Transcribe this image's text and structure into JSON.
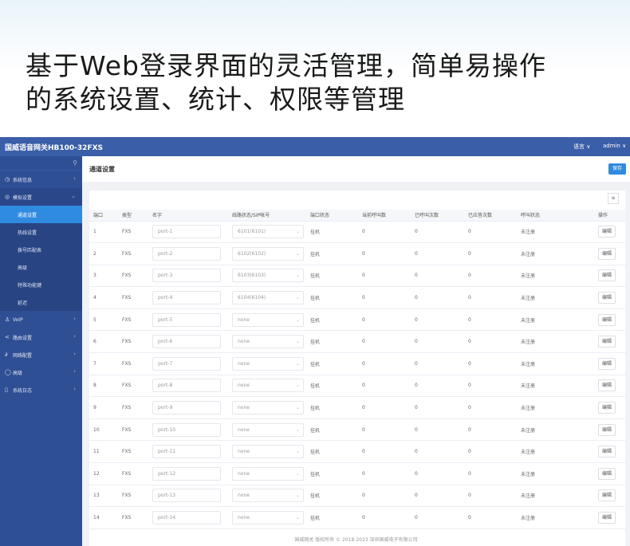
{
  "banner": {
    "line1": "基于Web登录界面的灵活管理，简单易操作",
    "line2": "的系统设置、统计、权限等管理"
  },
  "topbar": {
    "brand": "国威语音网关HB100-32FXS",
    "language": "语言 ∨",
    "user": "admin ∨"
  },
  "sidebar": {
    "items": [
      {
        "label": "系统信息",
        "icon": "gauge-icon"
      },
      {
        "label": "模拟设置",
        "icon": "phone-icon"
      },
      {
        "label": "VoIP",
        "icon": "user-icon"
      },
      {
        "label": "路由设置",
        "icon": "share-icon"
      },
      {
        "label": "网络配置",
        "icon": "link-icon"
      },
      {
        "label": "高级",
        "icon": "circle-icon"
      },
      {
        "label": "系统日志",
        "icon": "doc-icon"
      }
    ],
    "sub_items": [
      "通道设置",
      "热线设置",
      "拨号匹配表",
      "高级",
      "特殊功能键",
      "延迟"
    ]
  },
  "page": {
    "title": "通道设置",
    "save_label": "保存"
  },
  "table": {
    "headers": [
      "端口",
      "类型",
      "名字",
      "线路状态/SIP帐号",
      "端口状态",
      "当前呼叫数",
      "已呼叫次数",
      "已应答次数",
      "呼叫状态",
      "操作"
    ],
    "rows": [
      {
        "port": "1",
        "type": "FXS",
        "name": "port-1",
        "account": "6101(6101)",
        "status": "挂机",
        "current": "0",
        "called": "0",
        "answered": "0",
        "call_status": "未注册",
        "action": "编辑"
      },
      {
        "port": "2",
        "type": "FXS",
        "name": "port-2",
        "account": "6102(6102)",
        "status": "挂机",
        "current": "0",
        "called": "0",
        "answered": "0",
        "call_status": "未注册",
        "action": "编辑"
      },
      {
        "port": "3",
        "type": "FXS",
        "name": "port-3",
        "account": "6103(6103)",
        "status": "挂机",
        "current": "0",
        "called": "0",
        "answered": "0",
        "call_status": "未注册",
        "action": "编辑"
      },
      {
        "port": "4",
        "type": "FXS",
        "name": "port-4",
        "account": "6104(6104)",
        "status": "挂机",
        "current": "0",
        "called": "0",
        "answered": "0",
        "call_status": "未注册",
        "action": "编辑"
      },
      {
        "port": "5",
        "type": "FXS",
        "name": "port-5",
        "account": "none",
        "status": "挂机",
        "current": "0",
        "called": "0",
        "answered": "0",
        "call_status": "未注册",
        "action": "编辑"
      },
      {
        "port": "6",
        "type": "FXS",
        "name": "port-6",
        "account": "none",
        "status": "挂机",
        "current": "0",
        "called": "0",
        "answered": "0",
        "call_status": "未注册",
        "action": "编辑"
      },
      {
        "port": "7",
        "type": "FXS",
        "name": "port-7",
        "account": "none",
        "status": "挂机",
        "current": "0",
        "called": "0",
        "answered": "0",
        "call_status": "未注册",
        "action": "编辑"
      },
      {
        "port": "8",
        "type": "FXS",
        "name": "port-8",
        "account": "none",
        "status": "挂机",
        "current": "0",
        "called": "0",
        "answered": "0",
        "call_status": "未注册",
        "action": "编辑"
      },
      {
        "port": "9",
        "type": "FXS",
        "name": "port-9",
        "account": "none",
        "status": "挂机",
        "current": "0",
        "called": "0",
        "answered": "0",
        "call_status": "未注册",
        "action": "编辑"
      },
      {
        "port": "10",
        "type": "FXS",
        "name": "port-10",
        "account": "none",
        "status": "挂机",
        "current": "0",
        "called": "0",
        "answered": "0",
        "call_status": "未注册",
        "action": "编辑"
      },
      {
        "port": "11",
        "type": "FXS",
        "name": "port-11",
        "account": "none",
        "status": "挂机",
        "current": "0",
        "called": "0",
        "answered": "0",
        "call_status": "未注册",
        "action": "编辑"
      },
      {
        "port": "12",
        "type": "FXS",
        "name": "port-12",
        "account": "none",
        "status": "挂机",
        "current": "0",
        "called": "0",
        "answered": "0",
        "call_status": "未注册",
        "action": "编辑"
      },
      {
        "port": "13",
        "type": "FXS",
        "name": "port-13",
        "account": "none",
        "status": "挂机",
        "current": "0",
        "called": "0",
        "answered": "0",
        "call_status": "未注册",
        "action": "编辑"
      },
      {
        "port": "14",
        "type": "FXS",
        "name": "port-14",
        "account": "none",
        "status": "挂机",
        "current": "0",
        "called": "0",
        "answered": "0",
        "call_status": "未注册",
        "action": "编辑"
      }
    ]
  },
  "footer": "国威网关 版权所有 © 2018-2023 深圳国威电子有限公司"
}
